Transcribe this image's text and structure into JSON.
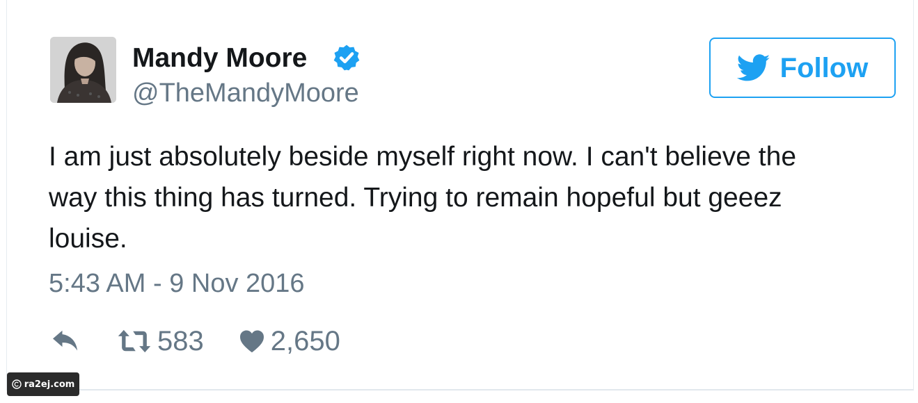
{
  "colors": {
    "twitter_blue": "#1da1f2",
    "text_primary": "#14171a",
    "text_secondary": "#657786"
  },
  "tweet": {
    "author": {
      "name": "Mandy Moore",
      "handle": "@TheMandyMoore",
      "verified": true,
      "verified_icon": "verified-badge-icon",
      "avatar_icon": "avatar-photo"
    },
    "follow_button": {
      "label": "Follow",
      "icon": "twitter-bird-icon"
    },
    "text_lines": [
      "I am just absolutely beside myself right now. I can't believe the",
      "way this thing has turned. Trying to remain hopeful but geeez",
      "louise."
    ],
    "timestamp": "5:43 AM - 9 Nov 2016",
    "actions": {
      "reply_icon": "reply-icon",
      "retweet_icon": "retweet-icon",
      "retweet_count": "583",
      "like_icon": "heart-icon",
      "like_count": "2,650"
    }
  },
  "watermark": {
    "icon": "copyright-icon",
    "text": "ra2ej.com"
  }
}
